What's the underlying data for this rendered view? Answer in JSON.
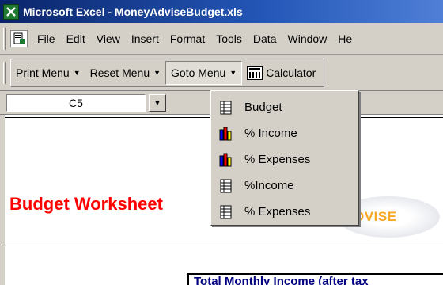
{
  "window": {
    "title": "Microsoft Excel - MoneyAdviseBudget.xls"
  },
  "menubar": {
    "items": [
      {
        "label": "File",
        "accel": "F"
      },
      {
        "label": "Edit",
        "accel": "E"
      },
      {
        "label": "View",
        "accel": "V"
      },
      {
        "label": "Insert",
        "accel": "I"
      },
      {
        "label": "Format",
        "accel": "o"
      },
      {
        "label": "Tools",
        "accel": "T"
      },
      {
        "label": "Data",
        "accel": "D"
      },
      {
        "label": "Window",
        "accel": "W"
      },
      {
        "label": "He",
        "accel": "H"
      }
    ]
  },
  "toolbar": {
    "print_menu": "Print Menu",
    "reset_menu": "Reset Menu",
    "goto_menu": "Goto Menu",
    "calculator": "Calculator"
  },
  "formula_bar": {
    "name_box": "C5"
  },
  "sheet": {
    "heading": "Budget Worksheet",
    "logo_text": "DVISE",
    "table_header": "Total Monthly Income (after tax"
  },
  "goto_dropdown": {
    "items": [
      {
        "label": "Budget",
        "icon": "worksheet-icon"
      },
      {
        "label": "% Income",
        "icon": "bar-chart-icon"
      },
      {
        "label": "% Expenses",
        "icon": "bar-chart-icon"
      },
      {
        "label": "%Income",
        "icon": "worksheet-icon"
      },
      {
        "label": "% Expenses",
        "icon": "worksheet-icon"
      }
    ]
  },
  "colors": {
    "title_bar": "#0a246a",
    "heading": "#ff0000",
    "logo": "#f5a623",
    "chrome": "#d4d0c8"
  }
}
